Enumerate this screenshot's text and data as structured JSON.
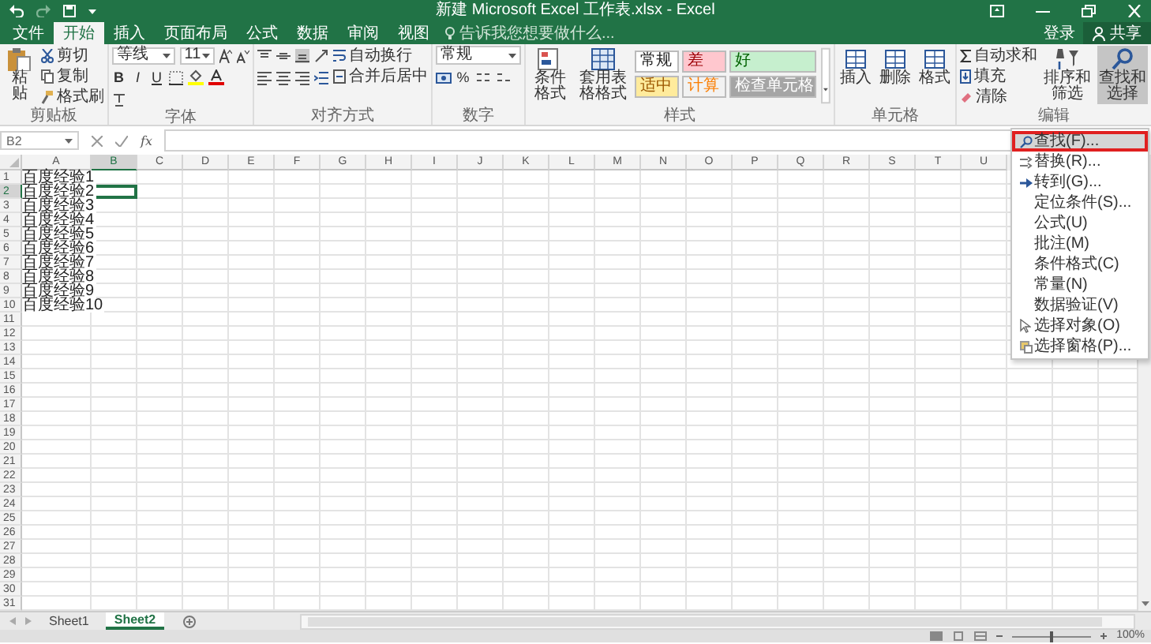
{
  "title_bar": {
    "title": "新建 Microsoft Excel 工作表.xlsx - Excel"
  },
  "menu_tabs": {
    "tabs": [
      {
        "label": "文件",
        "selected": false
      },
      {
        "label": "开始",
        "selected": true
      },
      {
        "label": "插入",
        "selected": false
      },
      {
        "label": "页面布局",
        "selected": false
      },
      {
        "label": "公式",
        "selected": false
      },
      {
        "label": "数据",
        "selected": false
      },
      {
        "label": "审阅",
        "selected": false
      },
      {
        "label": "视图",
        "selected": false
      }
    ],
    "tell_me": {
      "placeholder": "告诉我您想要做什么..."
    },
    "sign_in": "登录",
    "share": "共享"
  },
  "ribbon": {
    "clipboard": {
      "label": "剪贴板",
      "paste": "粘贴",
      "cut": "剪切",
      "copy": "复制",
      "format_painter": "格式刷"
    },
    "font": {
      "label": "字体",
      "font_name": "等线",
      "font_size": "11",
      "bold": "B",
      "italic": "I",
      "underline": "U"
    },
    "alignment": {
      "label": "对齐方式",
      "wrap_text": "自动换行",
      "merge_center": "合并后居中"
    },
    "number": {
      "label": "数字",
      "format": "常规",
      "percent": "%"
    },
    "styles": {
      "label": "样式",
      "conditional_formatting": "条件格式",
      "format_as_table": "套用表格格式",
      "cell_styles": [
        {
          "label": "常规",
          "kind": "normal",
          "color": "#ffffff"
        },
        {
          "label": "差",
          "kind": "bad",
          "color": "#ffc7ce"
        },
        {
          "label": "好",
          "kind": "good",
          "color": "#c6efce"
        },
        {
          "label": "适中",
          "kind": "neutral",
          "color": "#ffeb9c"
        },
        {
          "label": "计算",
          "kind": "calculation",
          "color": "#f2f2f2"
        },
        {
          "label": "检查单元格",
          "kind": "check",
          "color": "#a5a5a5"
        }
      ]
    },
    "cells": {
      "label": "单元格",
      "insert": "插入",
      "delete": "删除",
      "format": "格式"
    },
    "editing": {
      "label": "编辑",
      "autosum": "自动求和",
      "fill": "填充",
      "clear": "清除",
      "sort_filter": "排序和筛选",
      "find_select": {
        "label": "查找和选择",
        "pressed": true
      }
    }
  },
  "formula_bar": {
    "name_box": "B2",
    "function_label": "fx"
  },
  "grid": {
    "columns": [
      {
        "label": "A",
        "selected": false
      },
      {
        "label": "B",
        "selected": true
      },
      {
        "label": "C",
        "selected": false
      },
      {
        "label": "D",
        "selected": false
      },
      {
        "label": "E",
        "selected": false
      },
      {
        "label": "F",
        "selected": false
      },
      {
        "label": "G",
        "selected": false
      },
      {
        "label": "H",
        "selected": false
      },
      {
        "label": "I",
        "selected": false
      },
      {
        "label": "J",
        "selected": false
      },
      {
        "label": "K",
        "selected": false
      },
      {
        "label": "L",
        "selected": false
      },
      {
        "label": "M",
        "selected": false
      },
      {
        "label": "N",
        "selected": false
      },
      {
        "label": "O",
        "selected": false
      },
      {
        "label": "P",
        "selected": false
      },
      {
        "label": "Q",
        "selected": false
      },
      {
        "label": "R",
        "selected": false
      },
      {
        "label": "S",
        "selected": false
      },
      {
        "label": "T",
        "selected": false
      },
      {
        "label": "U",
        "selected": false
      }
    ],
    "rows": [
      {
        "label": "1",
        "selected": false,
        "cells": [
          "百度经验1"
        ]
      },
      {
        "label": "2",
        "selected": true,
        "cells": [
          "百度经验2"
        ]
      },
      {
        "label": "3",
        "selected": false,
        "cells": [
          "百度经验3"
        ]
      },
      {
        "label": "4",
        "selected": false,
        "cells": [
          "百度经验4"
        ]
      },
      {
        "label": "5",
        "selected": false,
        "cells": [
          "百度经验5"
        ]
      },
      {
        "label": "6",
        "selected": false,
        "cells": [
          "百度经验6"
        ]
      },
      {
        "label": "7",
        "selected": false,
        "cells": [
          "百度经验7"
        ]
      },
      {
        "label": "8",
        "selected": false,
        "cells": [
          "百度经验8"
        ]
      },
      {
        "label": "9",
        "selected": false,
        "cells": [
          "百度经验9"
        ]
      },
      {
        "label": "10",
        "selected": false,
        "cells": [
          "百度经验10"
        ]
      },
      {
        "label": "11",
        "selected": false
      },
      {
        "label": "12",
        "selected": false
      },
      {
        "label": "13",
        "selected": false
      },
      {
        "label": "14",
        "selected": false
      },
      {
        "label": "15",
        "selected": false
      },
      {
        "label": "16",
        "selected": false
      },
      {
        "label": "17",
        "selected": false
      },
      {
        "label": "18",
        "selected": false
      },
      {
        "label": "19",
        "selected": false
      },
      {
        "label": "20",
        "selected": false
      },
      {
        "label": "21",
        "selected": false
      },
      {
        "label": "22",
        "selected": false
      },
      {
        "label": "23",
        "selected": false
      },
      {
        "label": "24",
        "selected": false
      },
      {
        "label": "25",
        "selected": false
      },
      {
        "label": "26",
        "selected": false
      },
      {
        "label": "27",
        "selected": false
      },
      {
        "label": "28",
        "selected": false
      },
      {
        "label": "29",
        "selected": false
      },
      {
        "label": "30",
        "selected": false
      },
      {
        "label": "31",
        "selected": false
      }
    ]
  },
  "find_menu": {
    "items": [
      {
        "label": "查找(F)...",
        "kind": "find",
        "selected": true
      },
      {
        "label": "替换(R)...",
        "kind": "replace",
        "selected": false
      },
      {
        "label": "转到(G)...",
        "kind": "goto",
        "selected": false
      },
      {
        "label": "定位条件(S)...",
        "kind": "plain",
        "selected": false
      },
      {
        "label": "公式(U)",
        "kind": "plain",
        "selected": false
      },
      {
        "label": "批注(M)",
        "kind": "plain",
        "selected": false
      },
      {
        "label": "条件格式(C)",
        "kind": "plain",
        "selected": false
      },
      {
        "label": "常量(N)",
        "kind": "plain",
        "selected": false
      },
      {
        "label": "数据验证(V)",
        "kind": "plain",
        "selected": false
      },
      {
        "label": "选择对象(O)",
        "kind": "pointer",
        "selected": false
      },
      {
        "label": "选择窗格(P)...",
        "kind": "pane",
        "selected": false
      }
    ]
  },
  "sheet_tabs": [
    {
      "label": "Sheet1",
      "selected": false
    },
    {
      "label": "Sheet2",
      "selected": true
    }
  ],
  "status_bar": {
    "zoom_slider": {
      "level": 0.5
    },
    "zoom": "100%"
  }
}
